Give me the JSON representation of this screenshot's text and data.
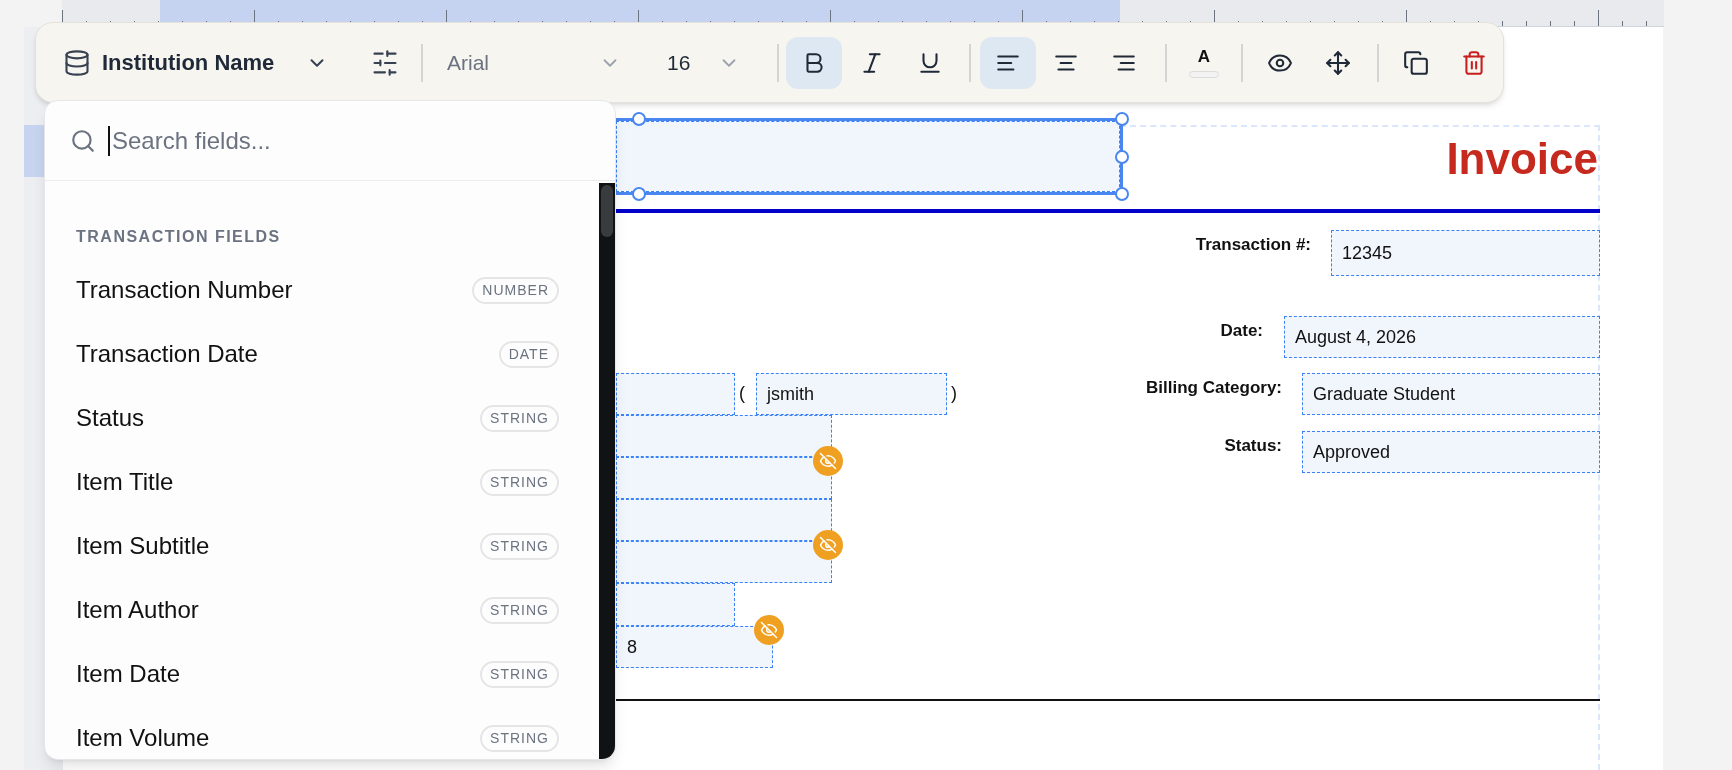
{
  "toolbar": {
    "field": "Institution Name",
    "font": "Arial",
    "size": "16",
    "style_buttons": [
      {
        "kind": "bold",
        "selected": true
      },
      {
        "kind": "italic",
        "selected": false
      },
      {
        "kind": "underline",
        "selected": false
      }
    ],
    "align_buttons": [
      {
        "kind": "left",
        "selected": true
      },
      {
        "kind": "center",
        "selected": false
      },
      {
        "kind": "right",
        "selected": false
      }
    ],
    "text_color_glyph": "A"
  },
  "field_picker": {
    "placeholder": "Search fields...",
    "group": "TRANSACTION FIELDS",
    "items": [
      {
        "label": "Transaction Number",
        "type": "NUMBER"
      },
      {
        "label": "Transaction Date",
        "type": "DATE"
      },
      {
        "label": "Status",
        "type": "STRING"
      },
      {
        "label": "Item Title",
        "type": "STRING"
      },
      {
        "label": "Item Subtitle",
        "type": "STRING"
      },
      {
        "label": "Item Author",
        "type": "STRING"
      },
      {
        "label": "Item Date",
        "type": "STRING"
      },
      {
        "label": "Item Volume",
        "type": "STRING"
      }
    ]
  },
  "document": {
    "title": "Invoice",
    "items": [
      {
        "kind": "field",
        "selected": true,
        "hidden": false
      },
      {
        "kind": "field",
        "selected": false,
        "hidden": false
      },
      {
        "kind": "text",
        "text": "("
      },
      {
        "kind": "field",
        "value": "jsmith",
        "selected": false,
        "hidden": false
      },
      {
        "kind": "text",
        "text": ")"
      },
      {
        "kind": "field",
        "selected": false,
        "hidden": false
      },
      {
        "kind": "field",
        "selected": false,
        "hidden": true
      },
      {
        "kind": "field",
        "selected": false,
        "hidden": false
      },
      {
        "kind": "field",
        "selected": false,
        "hidden": true
      },
      {
        "kind": "field",
        "selected": false,
        "hidden": false
      },
      {
        "kind": "field",
        "value": "8",
        "selected": false,
        "hidden": true
      }
    ],
    "details": [
      {
        "label": "Transaction #:",
        "value": "12345"
      },
      {
        "label": "Date:",
        "value": "August 4, 2026"
      },
      {
        "label": "Billing Category:",
        "value": "Graduate Student"
      },
      {
        "label": "Status:",
        "value": "Approved"
      }
    ]
  }
}
